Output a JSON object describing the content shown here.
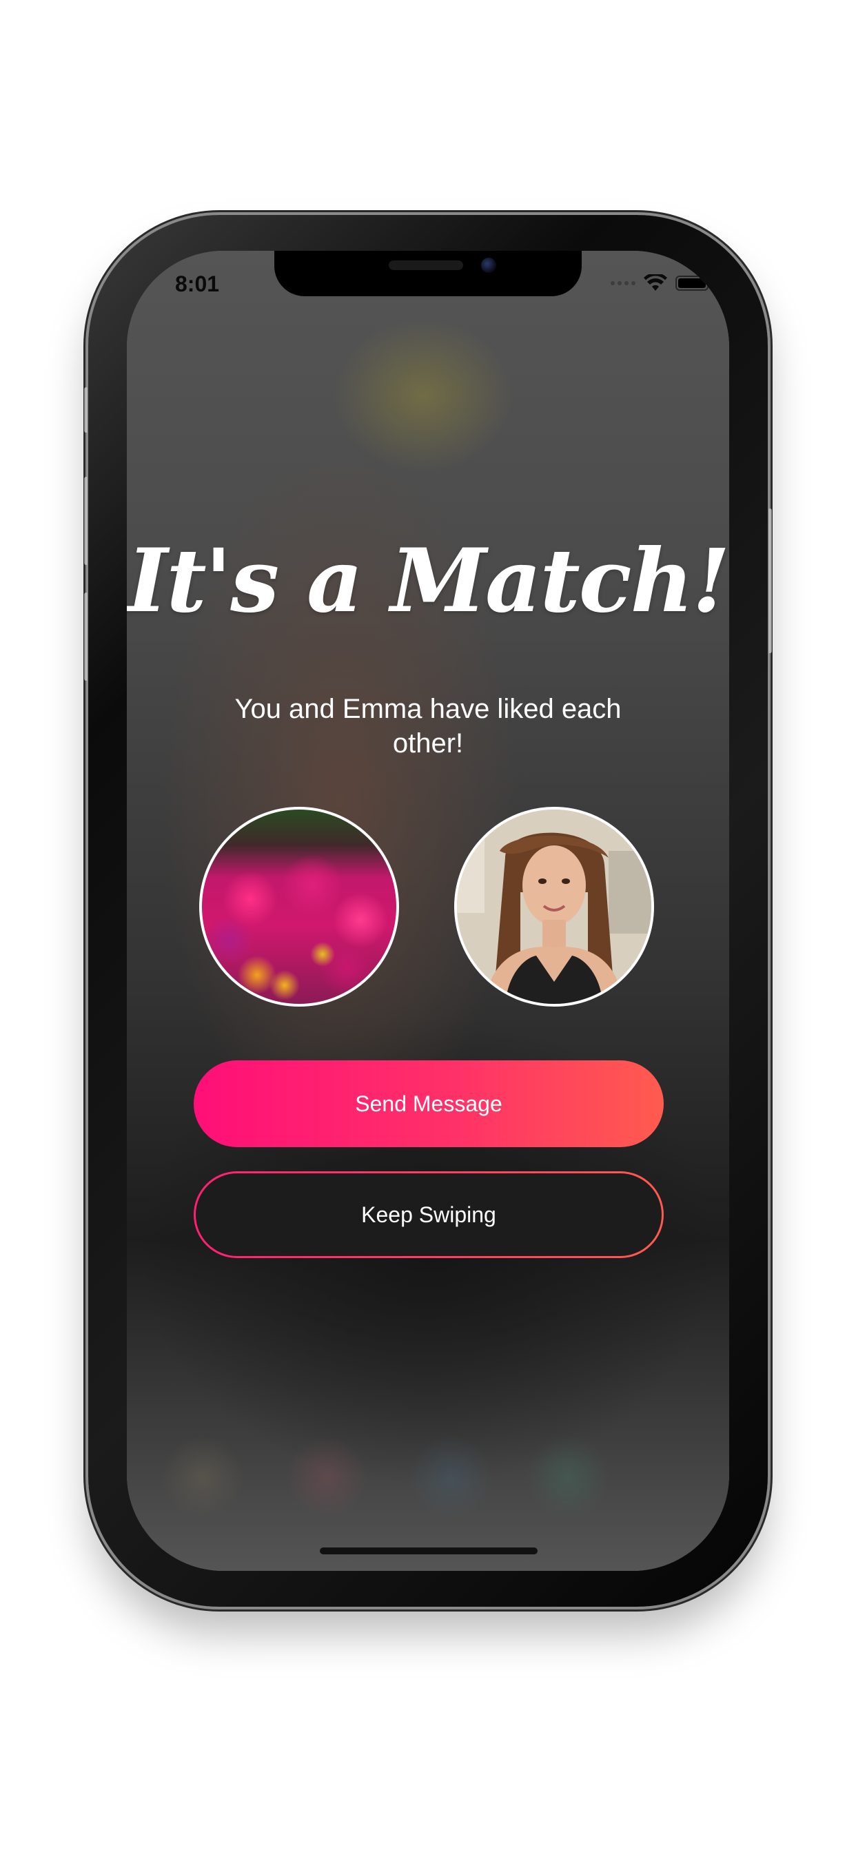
{
  "status_bar": {
    "time": "8:01",
    "wifi_icon": "wifi-icon",
    "battery_icon": "battery-icon",
    "battery_level": 1.0
  },
  "match": {
    "title": "It's a Match!",
    "subtitle": "You and Emma have liked each other!"
  },
  "avatars": {
    "left_icon": "flowers-photo",
    "right_icon": "woman-portrait-photo"
  },
  "buttons": {
    "send_message": "Send Message",
    "keep_swiping": "Keep Swiping"
  },
  "colors": {
    "accent_start": "#ff0f78",
    "accent_end": "#ff5b4f",
    "text": "#ffffff"
  }
}
